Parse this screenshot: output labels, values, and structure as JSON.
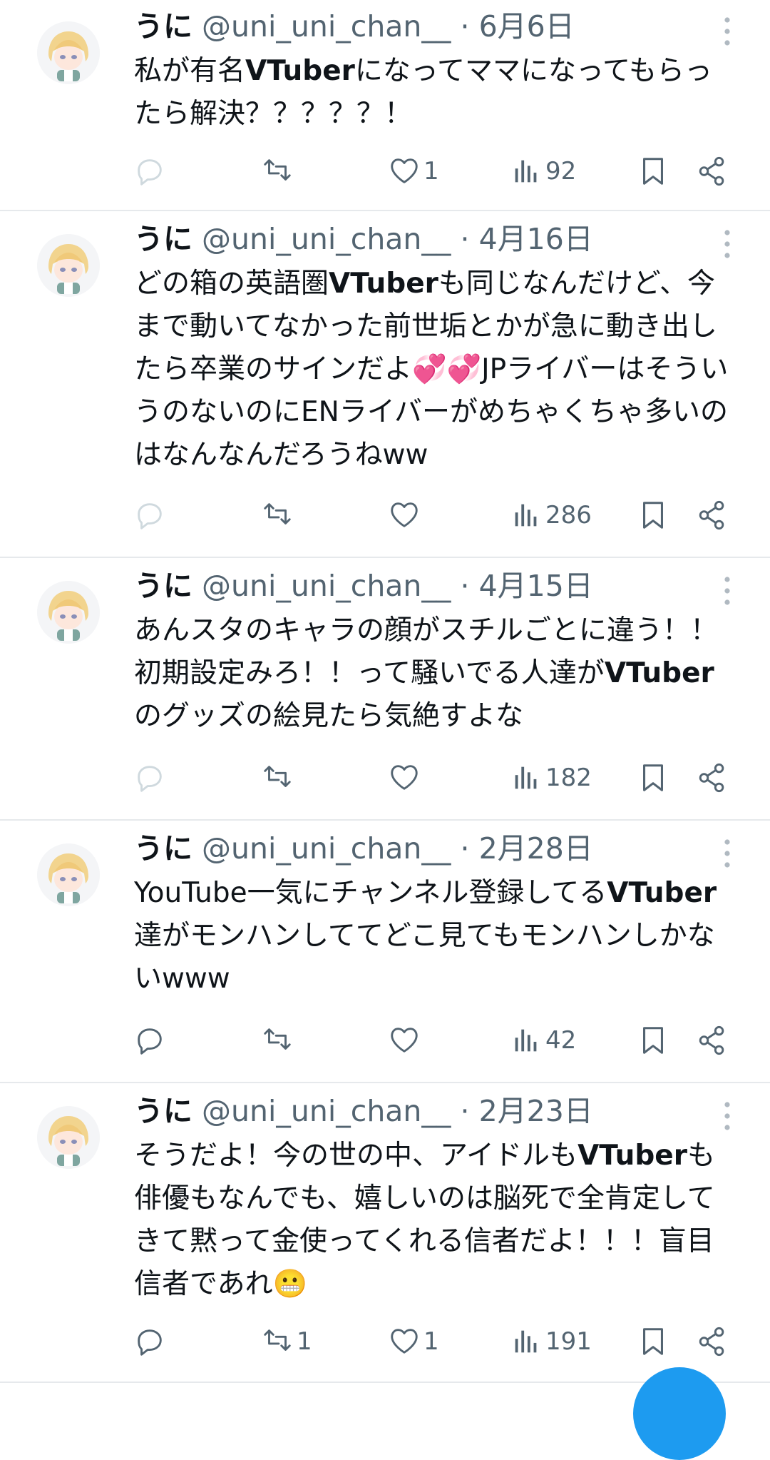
{
  "colors": {
    "text": "#0f1419",
    "muted": "#536471",
    "reply_light": "#cfd9de",
    "accent": "#1d9bf0",
    "divider": "#e6e9ec"
  },
  "tweets": [
    {
      "name": "うに",
      "handle": "@uni_uni_chan__",
      "separator": "·",
      "date": "6月6日",
      "body_segments": [
        {
          "text": "私が有名",
          "bold": false
        },
        {
          "text": "VTuber",
          "bold": true
        },
        {
          "text": "になってママになってもらったら解決？？？？？！",
          "bold": false
        }
      ],
      "replies": "",
      "retweets": "",
      "likes": "1",
      "views": "92",
      "reply_icon": "reply-light"
    },
    {
      "name": "うに",
      "handle": "@uni_uni_chan__",
      "separator": "·",
      "date": "4月16日",
      "body_segments": [
        {
          "text": "どの箱の英語圏",
          "bold": false
        },
        {
          "text": "VTuber",
          "bold": true
        },
        {
          "text": "も同じなんだけど、今まで動いてなかった前世垢とかが急に動き出したら卒業のサインだよ💞💞JPライバーはそういうのないのにENライバーがめちゃくちゃ多いのはなんなんだろうねww",
          "bold": false
        }
      ],
      "replies": "",
      "retweets": "",
      "likes": "",
      "views": "286",
      "reply_icon": "reply-light"
    },
    {
      "name": "うに",
      "handle": "@uni_uni_chan__",
      "separator": "·",
      "date": "4月15日",
      "body_segments": [
        {
          "text": "あんスタのキャラの顔がスチルごとに違う！！初期設定みろ！！って騒いでる人達が",
          "bold": false
        },
        {
          "text": "VTuber",
          "bold": true
        },
        {
          "text": "のグッズの絵見たら気絶すよな",
          "bold": false
        }
      ],
      "replies": "",
      "retweets": "",
      "likes": "",
      "views": "182",
      "reply_icon": "reply-light"
    },
    {
      "name": "うに",
      "handle": "@uni_uni_chan__",
      "separator": "·",
      "date": "2月28日",
      "body_segments": [
        {
          "text": "YouTube一気にチャンネル登録してる",
          "bold": false
        },
        {
          "text": "VTuber",
          "bold": true
        },
        {
          "text": "達がモンハンしててどこ見てもモンハンしかないwww",
          "bold": false
        }
      ],
      "replies": "",
      "retweets": "",
      "likes": "",
      "views": "42",
      "reply_icon": "reply-dark"
    },
    {
      "name": "うに",
      "handle": "@uni_uni_chan__",
      "separator": "·",
      "date": "2月23日",
      "body_segments": [
        {
          "text": "そうだよ！今の世の中、アイドルも",
          "bold": false
        },
        {
          "text": "VTuber",
          "bold": true
        },
        {
          "text": "も俳優もなんでも、嬉しいのは脳死で全肯定してきて黙って金使ってくれる信者だよ！！！盲目信者であれ😬",
          "bold": false
        }
      ],
      "replies": "",
      "retweets": "1",
      "likes": "1",
      "views": "191",
      "reply_icon": "reply-dark"
    }
  ]
}
